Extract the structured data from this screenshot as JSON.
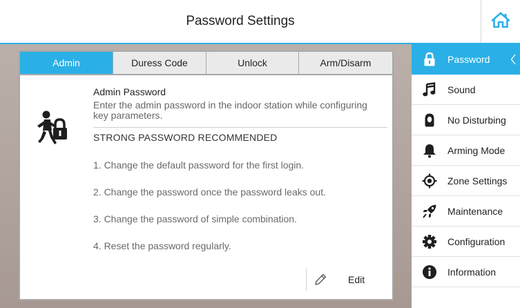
{
  "header": {
    "title": "Password Settings",
    "home_icon": "home-icon"
  },
  "tabs": [
    {
      "label": "Admin",
      "active": true
    },
    {
      "label": "Duress Code",
      "active": false
    },
    {
      "label": "Unlock",
      "active": false
    },
    {
      "label": "Arm/Disarm",
      "active": false
    }
  ],
  "content": {
    "icon": "admin-user-lock-icon",
    "title": "Admin Password",
    "description": "Enter the admin password in the indoor station while configuring key parameters.",
    "strong_heading": "STRONG PASSWORD RECOMMENDED",
    "tips": [
      "1. Change the default password for the first login.",
      "2. Change the password once the password leaks out.",
      "3. Change the password of simple combination.",
      "4. Reset the password regularly."
    ],
    "edit_label": "Edit",
    "edit_icon": "pencil-icon"
  },
  "sidebar": {
    "items": [
      {
        "label": "Password",
        "icon": "lock-icon",
        "active": true
      },
      {
        "label": "Sound",
        "icon": "music-note-icon",
        "active": false
      },
      {
        "label": "No Disturbing",
        "icon": "do-not-disturb-icon",
        "active": false
      },
      {
        "label": "Arming Mode",
        "icon": "bell-icon",
        "active": false
      },
      {
        "label": "Zone Settings",
        "icon": "target-icon",
        "active": false
      },
      {
        "label": "Maintenance",
        "icon": "rocket-icon",
        "active": false
      },
      {
        "label": "Configuration",
        "icon": "gear-icon",
        "active": false
      },
      {
        "label": "Information",
        "icon": "info-icon",
        "active": false
      }
    ]
  },
  "colors": {
    "accent": "#2ab0e6",
    "panel_border": "#a8a8a8",
    "tab_bg": "#eaeaea"
  }
}
